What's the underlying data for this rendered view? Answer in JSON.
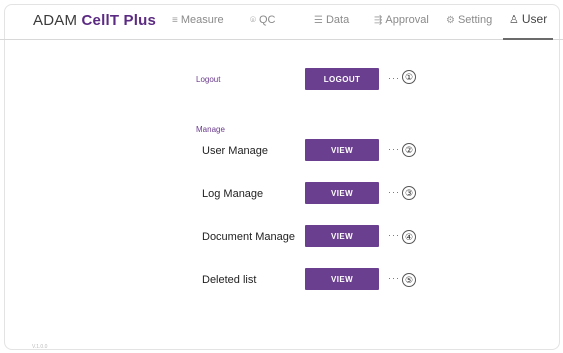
{
  "brand": {
    "prefix": "ADAM ",
    "name": "CellT Plus"
  },
  "nav": [
    {
      "icon": "≡",
      "label": "Measure"
    },
    {
      "icon": "⌾",
      "label": "QC"
    },
    {
      "icon": "☰",
      "label": "Data"
    },
    {
      "icon": "⇶",
      "label": "Approval"
    },
    {
      "icon": "⚙",
      "label": "Setting"
    },
    {
      "icon": "♙",
      "label": "User"
    }
  ],
  "logout": {
    "section_label": "Logout",
    "button": "LOGOUT",
    "dots": "···",
    "marker": "①"
  },
  "manage": {
    "section_label": "Manage",
    "rows": [
      {
        "label": "User Manage",
        "button": "VIEW",
        "dots": "···",
        "marker": "②"
      },
      {
        "label": "Log Manage",
        "button": "VIEW",
        "dots": "···",
        "marker": "③"
      },
      {
        "label": "Document Manage",
        "button": "VIEW",
        "dots": "···",
        "marker": "④"
      },
      {
        "label": "Deleted list",
        "button": "VIEW",
        "dots": "···",
        "marker": "⑤"
      }
    ]
  },
  "version": "V.1.0.0",
  "colors": {
    "accent": "#6b3f8f",
    "brand": "#5b2a82"
  }
}
